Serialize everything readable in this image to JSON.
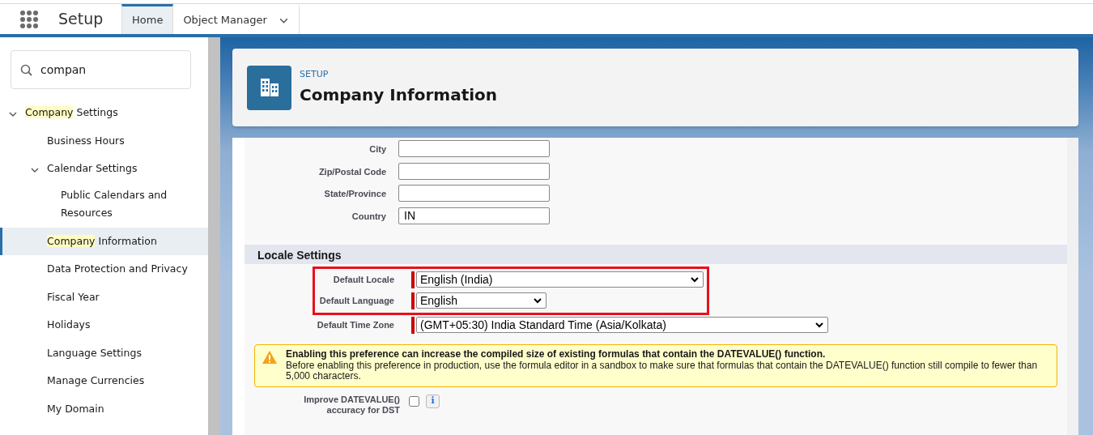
{
  "top_bar": {
    "title": "Setup",
    "tabs": [
      {
        "label": "Home",
        "selected": true,
        "dropdown": false
      },
      {
        "label": "Object Manager",
        "selected": false,
        "dropdown": true
      }
    ]
  },
  "sidebar": {
    "search": {
      "value": "compan"
    },
    "items": [
      {
        "highlight": "Company",
        "label": " Settings",
        "expanded": true,
        "selected": false,
        "children": [
          {
            "label": "Business Hours",
            "selected": false
          },
          {
            "label": "Calendar Settings",
            "expanded": true,
            "selected": false,
            "children": [
              {
                "label": "Public Calendars and Resources",
                "selected": false
              }
            ]
          },
          {
            "highlight": "Company",
            "label": " Information",
            "selected": true
          },
          {
            "label": "Data Protection and Privacy",
            "selected": false
          },
          {
            "label": "Fiscal Year",
            "selected": false
          },
          {
            "label": "Holidays",
            "selected": false
          },
          {
            "label": "Language Settings",
            "selected": false
          },
          {
            "label": "Manage Currencies",
            "selected": false
          },
          {
            "label": "My Domain",
            "selected": false
          }
        ]
      }
    ]
  },
  "header": {
    "eyebrow": "SETUP",
    "title": "Company Information"
  },
  "address_fields": [
    {
      "label": "City"
    },
    {
      "label": "Zip/Postal Code"
    },
    {
      "label": "State/Province"
    },
    {
      "label": "Country",
      "value": "IN"
    }
  ],
  "locale_settings": {
    "title": "Locale Settings",
    "fields": [
      {
        "label": "Default Locale",
        "value": "English (India)",
        "required": true,
        "highlighted": true
      },
      {
        "label": "Default Language",
        "value": "English",
        "required": true,
        "highlighted": true
      },
      {
        "label": "Default Time Zone",
        "value": "(GMT+05:30) India Standard Time (Asia/Kolkata)",
        "required": true,
        "highlighted": false
      }
    ]
  },
  "warning": {
    "title": "Enabling this preference can increase the compiled size of existing formulas that contain the DATEVALUE() function.",
    "body": "Before enabling this preference in production, use the formula editor in a sandbox to make sure that formulas that contain the DATEVALUE() function still compile to fewer than 5,000 characters."
  },
  "checkbox_field": {
    "label": "Improve DATEVALUE() accuracy for DST",
    "checked": false,
    "info": "i"
  }
}
